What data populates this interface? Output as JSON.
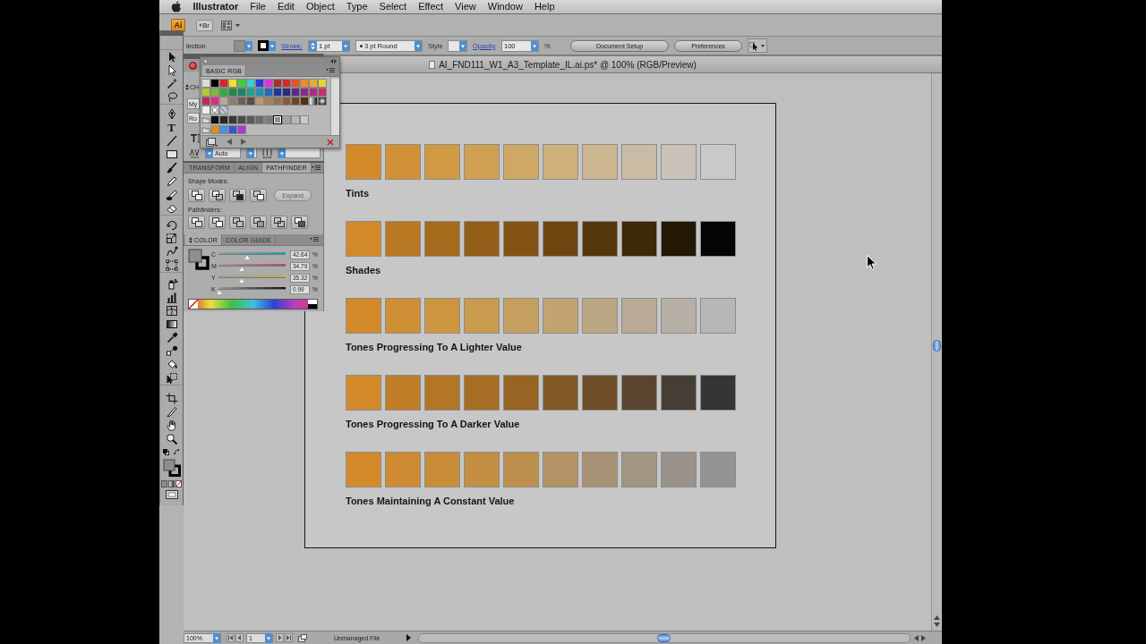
{
  "menu_bar": {
    "app_name": "Illustrator",
    "items": [
      "File",
      "Edit",
      "Object",
      "Type",
      "Select",
      "Effect",
      "View",
      "Window",
      "Help"
    ]
  },
  "app_bar": {
    "logo": "Ai",
    "bridge_label": "Br"
  },
  "control_bar": {
    "tool_name": "lection",
    "stroke_label": "Stroke:",
    "stroke_weight": "1 pt",
    "brush": "3 pt Round",
    "style_label": "Style",
    "opacity_label": "Opacity",
    "opacity": "100",
    "opacity_unit": "%",
    "buttons": [
      "Document Setup",
      "Preferences"
    ]
  },
  "tools_panel": {
    "type_tool_label": "T"
  },
  "document": {
    "title": "AI_FND111_W1_A3_Template_IL.ai.ps* @ 100% (RGB/Preview)",
    "swatch_rows": [
      {
        "label": "Tints",
        "swatches": [
          {
            "color": "#d38a2b"
          },
          {
            "color": "#d19136"
          },
          {
            "color": "#d09943"
          },
          {
            "color": "#cfa052"
          },
          {
            "color": "#cfa865"
          },
          {
            "color": "#ceb07a"
          },
          {
            "color": "#ccb68f"
          },
          {
            "color": "#cabca4"
          },
          {
            "color": "#c8c2b8"
          },
          {
            "color": "#c9c9c9"
          }
        ]
      },
      {
        "label": "Shades",
        "swatches": [
          {
            "color": "#d38a2b"
          },
          {
            "color": "#ba7a23"
          },
          {
            "color": "#a56b1d"
          },
          {
            "color": "#935e18"
          },
          {
            "color": "#845314"
          },
          {
            "color": "#6f4510"
          },
          {
            "color": "#55370c"
          },
          {
            "color": "#3d2808"
          },
          {
            "color": "#231804"
          },
          {
            "color": "#050403"
          }
        ]
      },
      {
        "label": "Tones Progressing To A Lighter Value",
        "swatches": [
          {
            "color": "#d38a2b"
          },
          {
            "color": "#cf8f34"
          },
          {
            "color": "#cc9640"
          },
          {
            "color": "#c89b4f"
          },
          {
            "color": "#c5a060"
          },
          {
            "color": "#c1a471"
          },
          {
            "color": "#bba784"
          },
          {
            "color": "#b8aa95"
          },
          {
            "color": "#b6afa6"
          },
          {
            "color": "#b7b7b7"
          }
        ]
      },
      {
        "label": "Tones Progressing To A Darker Value",
        "swatches": [
          {
            "color": "#d38a2b"
          },
          {
            "color": "#c07e28"
          },
          {
            "color": "#b37526"
          },
          {
            "color": "#a76d25"
          },
          {
            "color": "#986424"
          },
          {
            "color": "#835826"
          },
          {
            "color": "#6e4f2a"
          },
          {
            "color": "#594530"
          },
          {
            "color": "#463d34"
          },
          {
            "color": "#353535"
          }
        ]
      },
      {
        "label": "Tones Maintaining A Constant Value",
        "swatches": [
          {
            "color": "#d38a2b"
          },
          {
            "color": "#ce8b31"
          },
          {
            "color": "#c98d3a"
          },
          {
            "color": "#c48f43"
          },
          {
            "color": "#be904e"
          },
          {
            "color": "#b49265"
          },
          {
            "color": "#a89275"
          },
          {
            "color": "#a29582"
          },
          {
            "color": "#9a938b"
          },
          {
            "color": "#949494"
          }
        ]
      }
    ]
  },
  "character_panel": {
    "tab": "CH",
    "font_family": "My",
    "font_style": "Ro",
    "kerning": "Auto"
  },
  "swatches_panel": {
    "tab": "BASIC RGB",
    "rows": [
      {
        "group": false,
        "swatches": [
          {
            "kind": "color",
            "color": "#dcdcdc",
            "selected": false
          },
          {
            "kind": "color",
            "color": "#000000",
            "selected": false
          },
          {
            "kind": "color",
            "color": "#e02424",
            "selected": false
          },
          {
            "kind": "color",
            "color": "#eee02c",
            "selected": false
          },
          {
            "kind": "color",
            "color": "#3cd23c",
            "selected": false
          },
          {
            "kind": "color",
            "color": "#32d2d2",
            "selected": false
          },
          {
            "kind": "color",
            "color": "#2838dc",
            "selected": false
          },
          {
            "kind": "color",
            "color": "#dc32dc",
            "selected": false
          },
          {
            "kind": "color",
            "color": "#a83030",
            "selected": false
          },
          {
            "kind": "color",
            "color": "#d42c2c",
            "selected": false
          },
          {
            "kind": "color",
            "color": "#e0552a",
            "selected": false
          },
          {
            "kind": "color",
            "color": "#e88c2c",
            "selected": false
          },
          {
            "kind": "color",
            "color": "#e8ac34",
            "selected": false
          },
          {
            "kind": "color",
            "color": "#e4d432",
            "selected": false
          }
        ]
      },
      {
        "group": false,
        "swatches": [
          {
            "kind": "color",
            "color": "#b8c834",
            "selected": false
          },
          {
            "kind": "color",
            "color": "#84b83a",
            "selected": false
          },
          {
            "kind": "color",
            "color": "#34a844",
            "selected": false
          },
          {
            "kind": "color",
            "color": "#228a44",
            "selected": false
          },
          {
            "kind": "color",
            "color": "#1c8462",
            "selected": false
          },
          {
            "kind": "color",
            "color": "#22a08c",
            "selected": false
          },
          {
            "kind": "color",
            "color": "#2290b8",
            "selected": false
          },
          {
            "kind": "color",
            "color": "#2468b8",
            "selected": false
          },
          {
            "kind": "color",
            "color": "#243898",
            "selected": false
          },
          {
            "kind": "color",
            "color": "#2c2a7c",
            "selected": false
          },
          {
            "kind": "color",
            "color": "#5a2a8a",
            "selected": false
          },
          {
            "kind": "color",
            "color": "#8a2a8a",
            "selected": false
          },
          {
            "kind": "color",
            "color": "#b02a80",
            "selected": false
          },
          {
            "kind": "color",
            "color": "#cc2a6c",
            "selected": false
          }
        ]
      },
      {
        "group": false,
        "swatches": [
          {
            "kind": "color",
            "color": "#c02a5a",
            "selected": false
          },
          {
            "kind": "color",
            "color": "#e02a8a",
            "selected": false
          },
          {
            "kind": "color",
            "color": "#b8a898",
            "selected": false
          },
          {
            "kind": "color",
            "color": "#8c8070",
            "selected": false
          },
          {
            "kind": "color",
            "color": "#6c6054",
            "selected": false
          },
          {
            "kind": "color",
            "color": "#5a4e46",
            "selected": false
          },
          {
            "kind": "color",
            "color": "#b89878",
            "selected": false
          },
          {
            "kind": "color",
            "color": "#a88060",
            "selected": false
          },
          {
            "kind": "color",
            "color": "#987050",
            "selected": false
          },
          {
            "kind": "color",
            "color": "#885a3a",
            "selected": false
          },
          {
            "kind": "color",
            "color": "#704428",
            "selected": false
          },
          {
            "kind": "color",
            "color": "#503018",
            "selected": false
          },
          {
            "kind": "linear_gradient",
            "selected": false
          },
          {
            "kind": "radial_gradient",
            "selected": false
          }
        ]
      },
      {
        "group": false,
        "swatches": [
          {
            "kind": "color",
            "color": "#ececec",
            "selected": false
          },
          {
            "kind": "dot_pattern",
            "selected": false
          },
          {
            "kind": "texture_pattern",
            "selected": false
          }
        ]
      },
      {
        "group": true,
        "swatches": [
          {
            "kind": "color",
            "color": "#101010",
            "selected": false
          },
          {
            "kind": "color",
            "color": "#282828",
            "selected": false
          },
          {
            "kind": "color",
            "color": "#383838",
            "selected": false
          },
          {
            "kind": "color",
            "color": "#4a4a4a",
            "selected": false
          },
          {
            "kind": "color",
            "color": "#5a5a5a",
            "selected": false
          },
          {
            "kind": "color",
            "color": "#6a6a6a",
            "selected": false
          },
          {
            "kind": "color",
            "color": "#7c7c7c",
            "selected": false
          },
          {
            "kind": "color",
            "color": "#8e8e8e",
            "selected": true
          },
          {
            "kind": "color",
            "color": "#a2a2a2",
            "selected": false
          },
          {
            "kind": "color",
            "color": "#b6b6b6",
            "selected": false
          },
          {
            "kind": "color",
            "color": "#cacaca",
            "selected": false
          }
        ]
      },
      {
        "group": true,
        "swatches": [
          {
            "kind": "color",
            "color": "#d8901e",
            "selected": false
          },
          {
            "kind": "color",
            "color": "#4a90e0",
            "selected": false
          },
          {
            "kind": "color",
            "color": "#3858d0",
            "selected": false
          },
          {
            "kind": "color",
            "color": "#a040d0",
            "selected": false
          }
        ]
      }
    ]
  },
  "pathfinder_panel": {
    "tabs": [
      {
        "label": "TRANSFORM",
        "selected": false
      },
      {
        "label": "ALIGN",
        "selected": false
      },
      {
        "label": "PATHFINDER",
        "selected": true
      }
    ],
    "shape_modes_label": "Shape Modes:",
    "expand_button": {
      "label": "Expand",
      "disabled": true
    },
    "pathfinders_label": "Pathfinders:"
  },
  "color_panel": {
    "tabs": [
      {
        "label": "COLOR",
        "selected": true
      },
      {
        "label": "COLOR GUIDE",
        "selected": false
      }
    ],
    "channels": [
      {
        "name": "C",
        "value": "42.64",
        "unit": "%",
        "level": 0.4264
      },
      {
        "name": "M",
        "value": "34.79",
        "unit": "%",
        "level": 0.3479
      },
      {
        "name": "Y",
        "value": "35.32",
        "unit": "%",
        "level": 0.3532
      },
      {
        "name": "K",
        "value": "0.99",
        "unit": "%",
        "level": 0.0099
      }
    ]
  },
  "status_bar": {
    "zoom": "100%",
    "artboard": "1",
    "status": "Unmanaged File"
  }
}
